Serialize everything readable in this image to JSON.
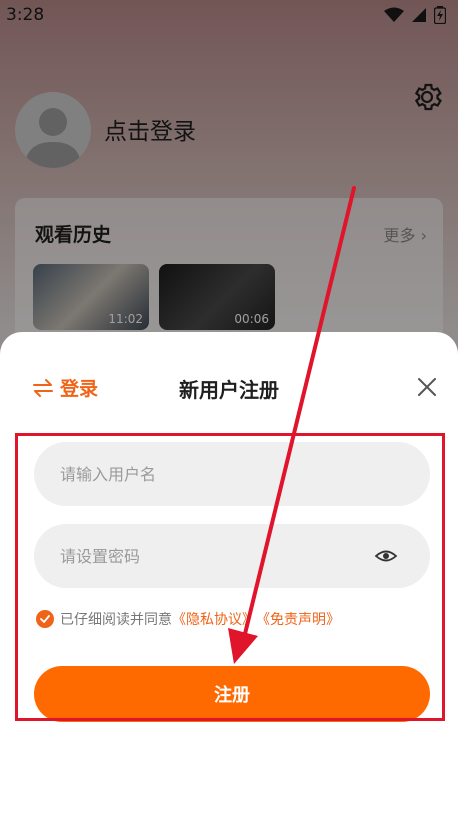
{
  "status_bar": {
    "time": "3:28"
  },
  "profile": {
    "login_prompt": "点击登录"
  },
  "history": {
    "title": "观看历史",
    "more": "更多",
    "items": [
      {
        "duration": "11:02"
      },
      {
        "duration": "00:06"
      }
    ]
  },
  "sheet": {
    "switch_label": "登录",
    "title": "新用户注册",
    "username_placeholder": "请输入用户名",
    "password_placeholder": "请设置密码",
    "agree_prefix": "已仔细阅读并同意",
    "privacy_link": "《隐私协议》",
    "disclaimer_link": "《免责声明》",
    "register_label": "注册"
  },
  "colors": {
    "accent": "#ff6a00",
    "link": "#f06419",
    "annotation": "#e0142b"
  }
}
